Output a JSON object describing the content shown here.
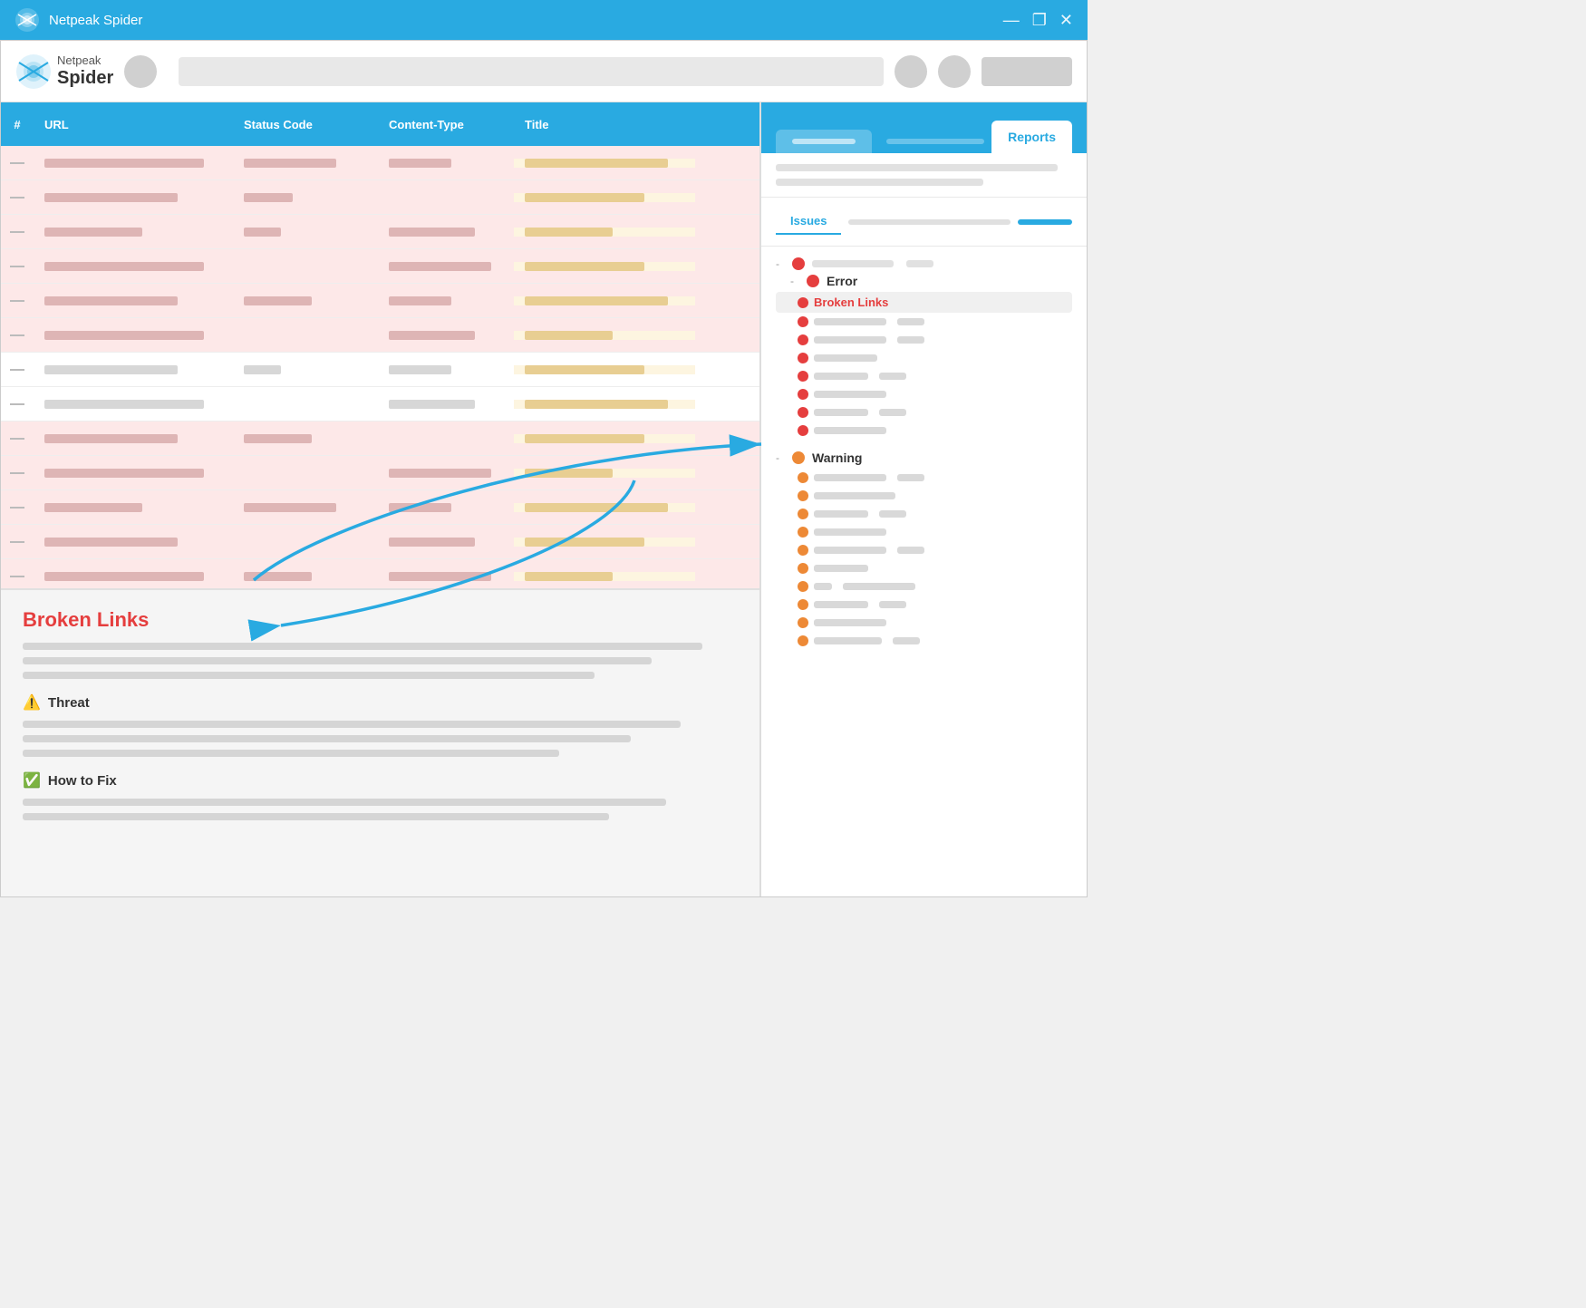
{
  "titleBar": {
    "appName": "Netpeak Spider",
    "controls": [
      "—",
      "❐",
      "✕"
    ]
  },
  "toolbar": {
    "logoText1": "Netpeak",
    "logoText2": "Spider"
  },
  "table": {
    "columns": [
      "#",
      "URL",
      "Status Code",
      "Content-Type",
      "Title"
    ],
    "rowCount": 13
  },
  "bottomPanel": {
    "brokenLinksTitle": "Broken Links",
    "threatLabel": "Threat",
    "howToFixLabel": "How to Fix"
  },
  "rightPanel": {
    "tabInactive": "",
    "tabActive": "Reports",
    "issuesTabActive": "Issues",
    "errorLabel": "Error",
    "brokenLinksLabel": "Broken Links",
    "warningLabel": "Warning"
  }
}
